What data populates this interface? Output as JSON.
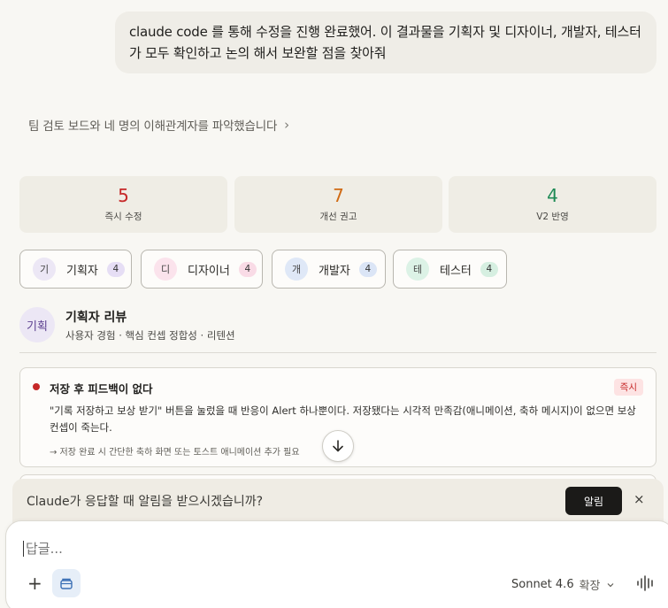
{
  "user_message": "claude code 를 통해 수정을 진행 완료했어. 이 결과물을 기획자 및 디자이너, 개발자, 테스터가 모두 확인하고 논의 해서 보완할 점을 찾아줘",
  "team_summary": "팀 검토 보드와 네 명의 이해관계자를 파악했습니다",
  "stats": [
    {
      "value": "5",
      "label": "즉시 수정",
      "color": "#c62828"
    },
    {
      "value": "7",
      "label": "개선 권고",
      "color": "#d06a14"
    },
    {
      "value": "4",
      "label": "V2 반영",
      "color": "#1e8a55"
    }
  ],
  "personas": [
    {
      "initial": "기",
      "name": "기획자",
      "count": "4",
      "avatar_bg": "#ece7f5",
      "count_bg": "#e6def5"
    },
    {
      "initial": "디",
      "name": "디자이너",
      "count": "4",
      "avatar_bg": "#fbe3ec",
      "count_bg": "#f9dbe6"
    },
    {
      "initial": "개",
      "name": "개발자",
      "count": "4",
      "avatar_bg": "#dfe8f7",
      "count_bg": "#dbe5f6"
    },
    {
      "initial": "테",
      "name": "테스터",
      "count": "4",
      "avatar_bg": "#dcf2e6",
      "count_bg": "#d6efe1"
    }
  ],
  "review": {
    "avatar": "기획",
    "title": "기획자 리뷰",
    "subtitle": "사용자 경험 · 핵심 컨셉 정합성 · 리텐션"
  },
  "issue": {
    "title": "저장 후 피드백이 없다",
    "badge": "즉시",
    "body": "\"기록 저장하고 보상 받기\" 버튼을 눌렀을 때 반응이 Alert 하나뿐이다. 저장됐다는 시각적 만족감(애니메이션, 축하 메시지)이 없으면 보상 컨셉이 죽는다.",
    "action": "→ 저장 완료 시 간단한 축하 화면 또는 토스트 애니메이션 추가 필요"
  },
  "notification": {
    "text": "Claude가 응답할 때 알림을 받으시겠습니까?",
    "button": "알림",
    "close": "×"
  },
  "composer": {
    "placeholder": "답글...",
    "model": "Sonnet 4.6",
    "mode": "확장"
  },
  "icons": [
    "chevron-right-icon",
    "arrow-down-icon",
    "close-icon",
    "plus-icon",
    "tool-icon",
    "chevron-down-icon",
    "voice-wave-icon"
  ]
}
